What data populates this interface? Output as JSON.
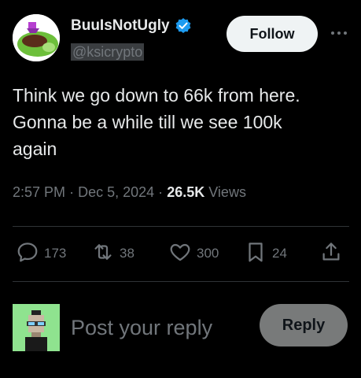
{
  "author": {
    "display_name": "BuuIsNotUgly",
    "handle": "@ksicrypto",
    "verified": true
  },
  "header": {
    "follow_label": "Follow",
    "more_icon": "more-horizontal-icon"
  },
  "tweet": {
    "text": "Think we go down to 66k from here.\nGonna be a while till we see 100k\nagain",
    "time": "2:57 PM",
    "separator": "·",
    "date": "Dec 5, 2024",
    "views_count": "26.5K",
    "views_label": "Views"
  },
  "actions": {
    "replies": "173",
    "reposts": "38",
    "likes": "300",
    "bookmarks": "24"
  },
  "reply": {
    "placeholder": "Post your reply",
    "button_label": "Reply"
  },
  "colors": {
    "background": "#000000",
    "text": "#e7e9ea",
    "muted": "#71767b",
    "verified": "#1d9bf0",
    "divider": "#2f3336"
  }
}
